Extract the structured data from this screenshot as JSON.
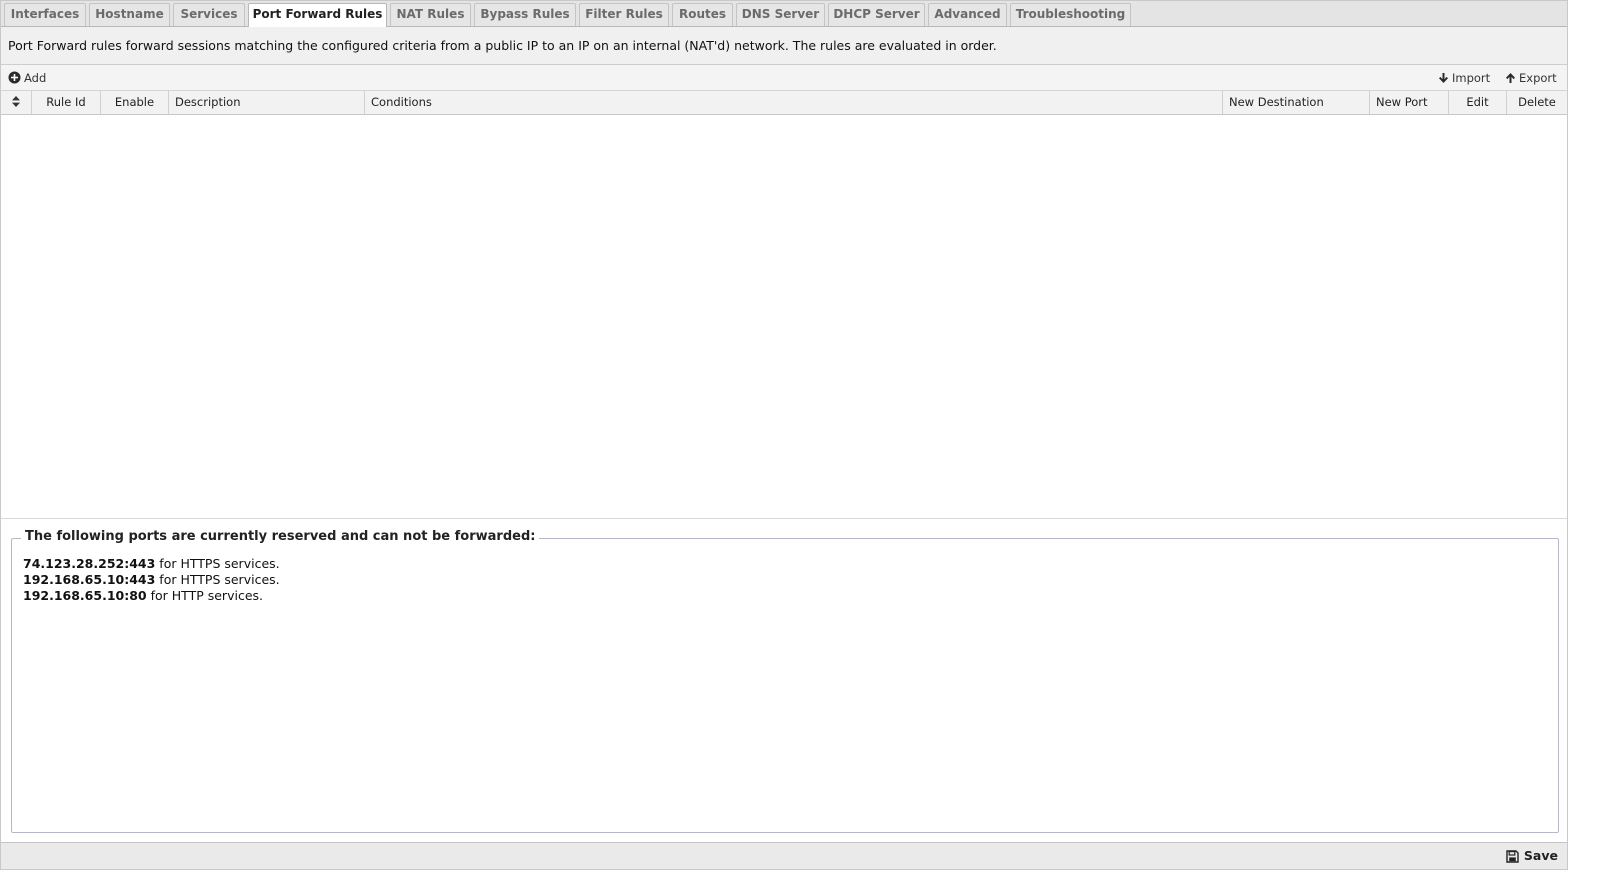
{
  "tabs": [
    {
      "label": "Interfaces",
      "active": false
    },
    {
      "label": "Hostname",
      "active": false
    },
    {
      "label": "Services",
      "active": false
    },
    {
      "label": "Port Forward Rules",
      "active": true
    },
    {
      "label": "NAT Rules",
      "active": false
    },
    {
      "label": "Bypass Rules",
      "active": false
    },
    {
      "label": "Filter Rules",
      "active": false
    },
    {
      "label": "Routes",
      "active": false
    },
    {
      "label": "DNS Server",
      "active": false
    },
    {
      "label": "DHCP Server",
      "active": false
    },
    {
      "label": "Advanced",
      "active": false
    },
    {
      "label": "Troubleshooting",
      "active": false
    }
  ],
  "description": "Port Forward rules forward sessions matching the configured criteria from a public IP to an IP on an internal (NAT'd) network. The rules are evaluated in order.",
  "toolbar": {
    "add_label": "Add",
    "import_label": "Import",
    "export_label": "Export"
  },
  "grid": {
    "columns": [
      "Rule Id",
      "Enable",
      "Description",
      "Conditions",
      "New Destination",
      "New Port",
      "Edit",
      "Delete"
    ],
    "rows": []
  },
  "reserved": {
    "title": "The following ports are currently reserved and can not be forwarded:",
    "items": [
      {
        "address": "74.123.28.252:443",
        "suffix": "for HTTPS services."
      },
      {
        "address": "192.168.65.10:443",
        "suffix": "for HTTPS services."
      },
      {
        "address": "192.168.65.10:80",
        "suffix": "for HTTP services."
      }
    ]
  },
  "footer": {
    "save_label": "Save"
  },
  "colors": {
    "active_tab_bg": "#ffffff",
    "tab_bg": "#e6e6e6",
    "fieldset_border": "#b4b8c8"
  }
}
